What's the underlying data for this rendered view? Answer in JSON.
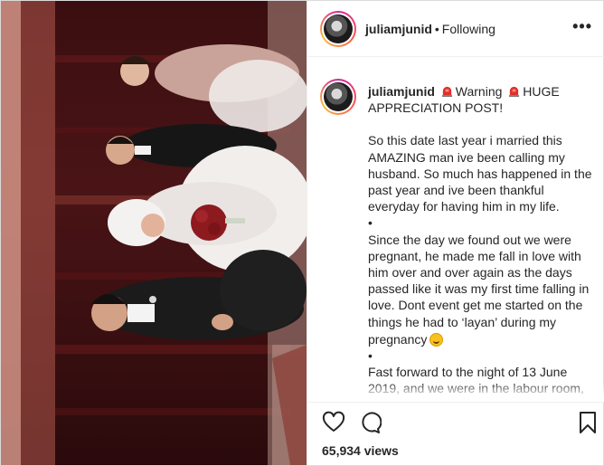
{
  "header": {
    "username": "juliamjunid",
    "separator": "•",
    "follow_status": "Following",
    "more_label": "•••"
  },
  "caption": {
    "username": "juliamjunid",
    "line1_a": "Warning",
    "line1_b": "HUGE APPRECIATION POST!",
    "para1": "So this date last year i married this AMAZING man ive been calling my husband. So much has happened in the past year and ive been thankful everyday for having him in my life.",
    "bullet": "•",
    "para2": "Since the day we found out we were pregnant, he made me fall in love with him over and over again as the days passed like it was my first time falling in love. Dont event get me started on the things he had to ‘layan’ during my pregnancy",
    "para3": "Fast forward to the night of 13 June 2019, and we were in the labour room,"
  },
  "footer": {
    "views": "65,934 views"
  },
  "icons": {
    "like": "heart-icon",
    "comment": "comment-icon",
    "save": "bookmark-icon",
    "siren": "police-light-emoji",
    "face": "laughing-face-emoji"
  },
  "colors": {
    "text": "#262626",
    "border": "#dbdbdb",
    "photo_bg": "#3a0e10",
    "siren": "#e0302b"
  }
}
